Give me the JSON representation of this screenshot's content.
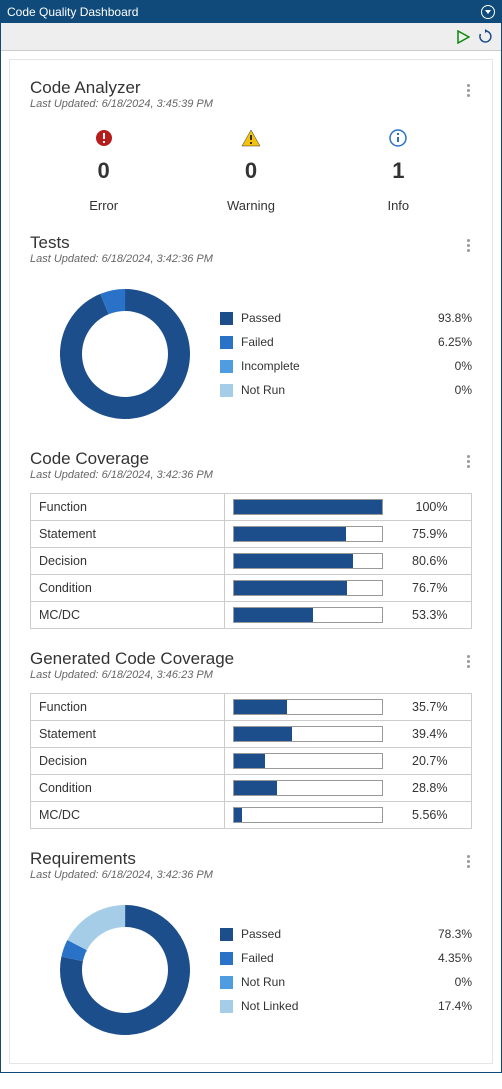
{
  "window": {
    "title": "Code Quality Dashboard"
  },
  "analyzer": {
    "title": "Code Analyzer",
    "updated_prefix": "Last Updated: ",
    "updated": "6/18/2024, 3:45:39 PM",
    "stats": [
      {
        "label": "Error",
        "value": "0",
        "icon": "error"
      },
      {
        "label": "Warning",
        "value": "0",
        "icon": "warning"
      },
      {
        "label": "Info",
        "value": "1",
        "icon": "info"
      }
    ]
  },
  "tests": {
    "title": "Tests",
    "updated": "6/18/2024, 3:42:36 PM",
    "items": [
      {
        "label": "Passed",
        "value": "93.8%",
        "pct": 93.8,
        "color": "#1c4e8c"
      },
      {
        "label": "Failed",
        "value": "6.25%",
        "pct": 6.25,
        "color": "#2a72c8"
      },
      {
        "label": "Incomplete",
        "value": "0%",
        "pct": 0,
        "color": "#4d9de0"
      },
      {
        "label": "Not Run",
        "value": "0%",
        "pct": 0,
        "color": "#a6cde8"
      }
    ]
  },
  "coverage": {
    "title": "Code Coverage",
    "updated": "6/18/2024, 3:42:36 PM",
    "rows": [
      {
        "label": "Function",
        "value": "100%",
        "pct": 100
      },
      {
        "label": "Statement",
        "value": "75.9%",
        "pct": 75.9
      },
      {
        "label": "Decision",
        "value": "80.6%",
        "pct": 80.6
      },
      {
        "label": "Condition",
        "value": "76.7%",
        "pct": 76.7
      },
      {
        "label": "MC/DC",
        "value": "53.3%",
        "pct": 53.3
      }
    ]
  },
  "gencoverage": {
    "title": "Generated Code Coverage",
    "updated": "6/18/2024, 3:46:23 PM",
    "rows": [
      {
        "label": "Function",
        "value": "35.7%",
        "pct": 35.7
      },
      {
        "label": "Statement",
        "value": "39.4%",
        "pct": 39.4
      },
      {
        "label": "Decision",
        "value": "20.7%",
        "pct": 20.7
      },
      {
        "label": "Condition",
        "value": "28.8%",
        "pct": 28.8
      },
      {
        "label": "MC/DC",
        "value": "5.56%",
        "pct": 5.56
      }
    ]
  },
  "requirements": {
    "title": "Requirements",
    "updated": "6/18/2024, 3:42:36 PM",
    "items": [
      {
        "label": "Passed",
        "value": "78.3%",
        "pct": 78.3,
        "color": "#1c4e8c"
      },
      {
        "label": "Failed",
        "value": "4.35%",
        "pct": 4.35,
        "color": "#2a72c8"
      },
      {
        "label": "Not Run",
        "value": "0%",
        "pct": 0,
        "color": "#4d9de0"
      },
      {
        "label": "Not Linked",
        "value": "17.4%",
        "pct": 17.4,
        "color": "#a6cde8"
      }
    ]
  },
  "chart_data": [
    {
      "type": "pie",
      "title": "Tests",
      "series": [
        {
          "name": "Tests",
          "values": [
            93.8,
            6.25,
            0,
            0
          ]
        }
      ],
      "categories": [
        "Passed",
        "Failed",
        "Incomplete",
        "Not Run"
      ]
    },
    {
      "type": "bar",
      "title": "Code Coverage",
      "categories": [
        "Function",
        "Statement",
        "Decision",
        "Condition",
        "MC/DC"
      ],
      "values": [
        100,
        75.9,
        80.6,
        76.7,
        53.3
      ],
      "ylim": [
        0,
        100
      ]
    },
    {
      "type": "bar",
      "title": "Generated Code Coverage",
      "categories": [
        "Function",
        "Statement",
        "Decision",
        "Condition",
        "MC/DC"
      ],
      "values": [
        35.7,
        39.4,
        20.7,
        28.8,
        5.56
      ],
      "ylim": [
        0,
        100
      ]
    },
    {
      "type": "pie",
      "title": "Requirements",
      "series": [
        {
          "name": "Requirements",
          "values": [
            78.3,
            4.35,
            0,
            17.4
          ]
        }
      ],
      "categories": [
        "Passed",
        "Failed",
        "Not Run",
        "Not Linked"
      ]
    }
  ]
}
